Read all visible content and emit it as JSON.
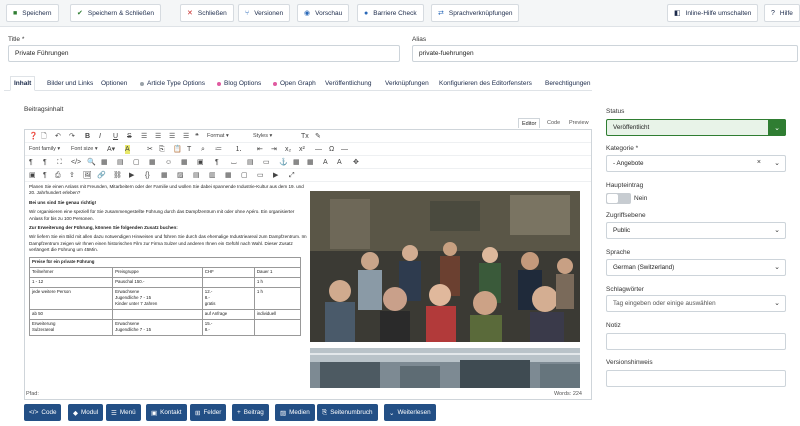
{
  "toolbar": {
    "save": "Speichern",
    "save_close": "Speichern & Schließen",
    "close": "Schließen",
    "versions": "Versionen",
    "preview": "Vorschau",
    "barriere": "Barriere Check",
    "lang_links": "Sprachverknüpfungen",
    "inline_help": "Inline-Hilfe umschalten",
    "help": "Hilfe"
  },
  "form": {
    "title_label": "Title *",
    "title_value": "Private Führungen",
    "alias_label": "Alias",
    "alias_value": "private-fuehrungen"
  },
  "tabs": [
    {
      "label": "Inhalt"
    },
    {
      "label": "Bilder und Links"
    },
    {
      "label": "Optionen"
    },
    {
      "label": "Article Type Options"
    },
    {
      "label": "Blog Options"
    },
    {
      "label": "Open Graph"
    },
    {
      "label": "Veröffentlichung"
    },
    {
      "label": "Verknüpfungen"
    },
    {
      "label": "Konfigurieren des Editorfensters"
    },
    {
      "label": "Berechtigungen"
    }
  ],
  "colors": {
    "accent": "#234f85",
    "green": "#2f7d32",
    "red": "#c52827"
  },
  "editor": {
    "label": "Beitragsinhalt",
    "tab_editor": "Editor",
    "tab_code": "Code",
    "tab_preview": "Preview",
    "format": "Format",
    "styles": "Styles",
    "font_family": "Font family",
    "font_size": "Font size",
    "para1": "Planen Sie einen Anlass mit Freunden, Mitarbeitern oder der Familie und wollen Sie dabei spannende Industrie-Kultur aus dem 19. und 20. Jahrhundert erleben?",
    "heading1": "Bei uns sind Sie genau richtig!",
    "para2": "Wir organisieren eine speziell für Sie zusammengestellte Führung durch das Dampfzentrum mit oder ohne Apéro. Ein organisierter Anlass für bis zu 100 Personen.",
    "heading2": "Zur Erweiterung der Führung, können Sie folgenden Zusatz buchen:",
    "para3": "Wir liefern Sie ein Bild mit allen dazu notwendigen Hinweisen und führen Sie durch das ehemalige Industrieareal zum Dampfzentrum. Im Dampfzentrum zeigen wir Ihnen einen historischen Film zur Firma Sulzer und anderen Ihnen ein Gefühl nach Wahl. Dieser Zusatz verlängert die Führung um 45Min.",
    "table": {
      "title": "Preise für ein private Führung",
      "headers": [
        "Teilnehmer",
        "Preisgruppe",
        "CHF",
        "Dauer 1"
      ],
      "rows": [
        [
          "1 - 12",
          "Pauschal 150.-",
          "",
          "1 h"
        ],
        [
          "jede weitere Person",
          "Erwachsene\nJugendliche 7 - 15\nKinder unter 7 Jahren",
          "12.-\n8.-\ngratis",
          "1 h"
        ],
        [
          "ab 50",
          "",
          "auf Anfrage",
          "individuell"
        ],
        [
          "Erweiterung\nSulzerareal",
          "Erwachsene\nJugendliche 7 - 15",
          "15.-\n8.-",
          ""
        ]
      ]
    },
    "status_path": "Pfad:",
    "word_count": "Words: 224"
  },
  "bottom_buttons": {
    "code": "Code",
    "module": "Modul",
    "menu": "Menü",
    "contact": "Kontakt",
    "fields": "Felder",
    "article": "Beitrag",
    "media": "Medien",
    "page_break": "Seitenumbruch",
    "read_more": "Weiterlesen"
  },
  "sidebar": {
    "status_label": "Status",
    "status_value": "Veröffentlicht",
    "category_label": "Kategorie *",
    "category_value": "- Angebote",
    "featured_label": "Haupteintrag",
    "featured_value": "Nein",
    "access_label": "Zugriffsebene",
    "access_value": "Public",
    "language_label": "Sprache",
    "language_value": "German (Switzerland)",
    "tags_label": "Schlagwörter",
    "tags_placeholder": "Tag eingeben oder einige auswählen",
    "note_label": "Notiz",
    "version_label": "Versionshinweis"
  }
}
